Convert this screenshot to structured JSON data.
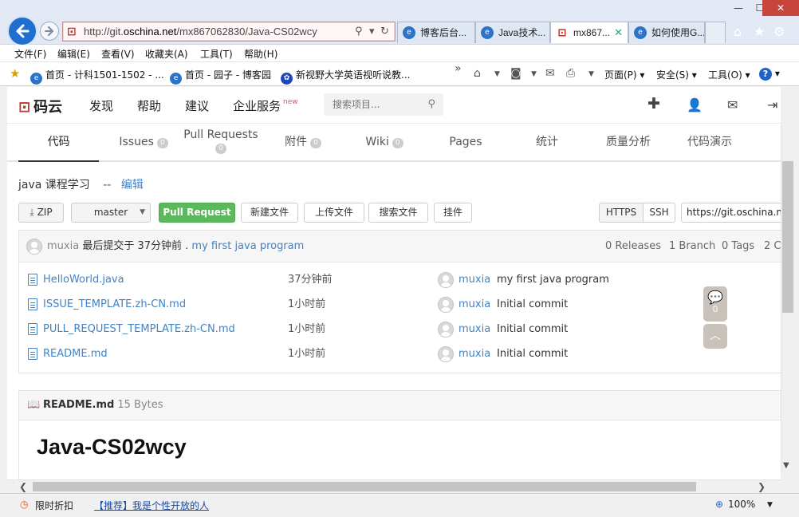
{
  "browser": {
    "url_prefix": "http://git.",
    "url_domain": "oschina.net",
    "url_path": "/mx867062830/Java-CS02wcy",
    "tabs": [
      {
        "label": "博客后台..."
      },
      {
        "label": "Java技术..."
      },
      {
        "label": "mx867..."
      },
      {
        "label": "如何使用G..."
      }
    ],
    "menu": [
      "文件(F)",
      "编辑(E)",
      "查看(V)",
      "收藏夹(A)",
      "工具(T)",
      "帮助(H)"
    ],
    "favorites": [
      {
        "label": "首页 - 计科1501-1502 - ..."
      },
      {
        "label": "首页 - 园子 - 博客园"
      },
      {
        "label": "新视野大学英语视听说教..."
      }
    ],
    "commands": {
      "page": "页面(P)",
      "safety": "安全(S)",
      "tools": "工具(O)"
    }
  },
  "site": {
    "logo": "码云",
    "nav": [
      "发现",
      "帮助",
      "建议",
      "企业服务"
    ],
    "new_badge": "new",
    "search_placeholder": "搜索项目..."
  },
  "repo_tabs": [
    {
      "label": "代码",
      "count": null
    },
    {
      "label": "Issues",
      "count": "0"
    },
    {
      "label": "Pull Requests",
      "count": "0"
    },
    {
      "label": "附件",
      "count": "0"
    },
    {
      "label": "Wiki",
      "count": "0"
    },
    {
      "label": "Pages",
      "count": null
    },
    {
      "label": "统计",
      "count": null
    },
    {
      "label": "质量分析",
      "count": null
    },
    {
      "label": "代码演示",
      "count": null
    }
  ],
  "repo": {
    "description": "java 课程学习",
    "separator": "--",
    "edit_label": "编辑"
  },
  "actions": {
    "zip": "ZIP",
    "branch": "master",
    "pull_request": "Pull Request",
    "new_file": "新建文件",
    "upload_file": "上传文件",
    "search_file": "搜索文件",
    "mount": "挂件",
    "https": "HTTPS",
    "ssh": "SSH",
    "clone_url": "https://git.oschina.net"
  },
  "commit": {
    "author": "muxia",
    "text": "最后提交于 37分钟前 .",
    "message": "my first java program",
    "releases": "0 Releases",
    "branches": "1 Branch",
    "tags": "0 Tags",
    "contributors": "2 C"
  },
  "files": [
    {
      "name": "HelloWorld.java",
      "time": "37分钟前",
      "author": "muxia",
      "message": "my first java program"
    },
    {
      "name": "ISSUE_TEMPLATE.zh-CN.md",
      "time": "1小时前",
      "author": "muxia",
      "message": "Initial commit"
    },
    {
      "name": "PULL_REQUEST_TEMPLATE.zh-CN.md",
      "time": "1小时前",
      "author": "muxia",
      "message": "Initial commit"
    },
    {
      "name": "README.md",
      "time": "1小时前",
      "author": "muxia",
      "message": "Initial commit"
    }
  ],
  "float": {
    "comment_count": "0"
  },
  "readme": {
    "filename": "README.md",
    "size": "15 Bytes",
    "heading": "Java-CS02wcy"
  },
  "status": {
    "mode": "限时折扣",
    "link": "【推荐】我是个性开放的人",
    "zoom": "100%"
  }
}
